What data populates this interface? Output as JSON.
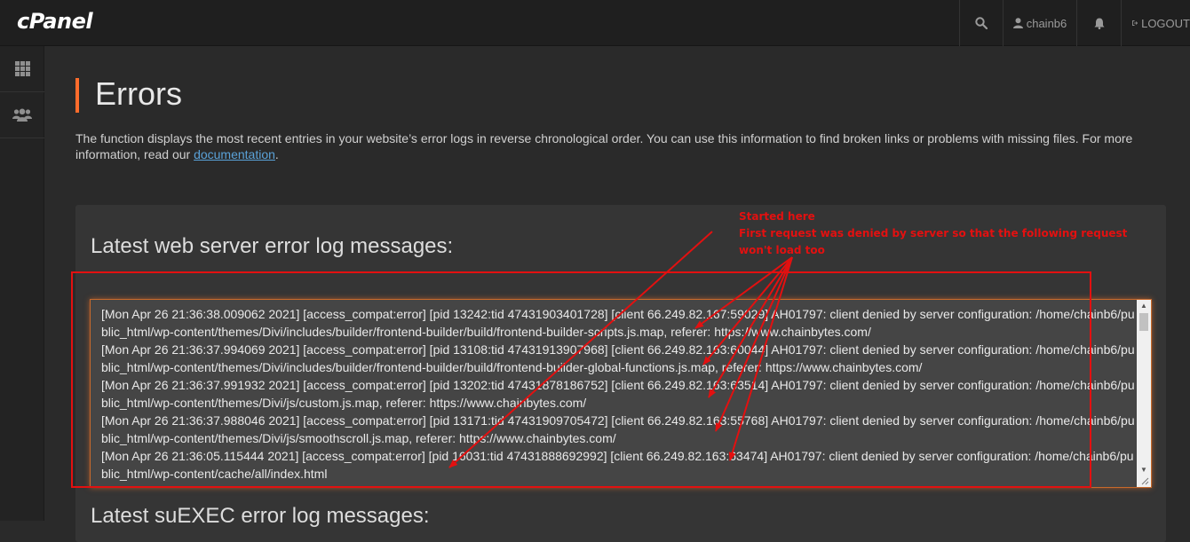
{
  "brand": "cPanel",
  "topnav": {
    "user": "chainb6",
    "logout": "LOGOUT"
  },
  "page": {
    "title": "Errors",
    "description_before": "The function displays the most recent entries in your website’s error logs in reverse chronological order. You can use this information to find broken links or problems with missing files. For more information, read our ",
    "doc_link": "documentation",
    "description_after": "."
  },
  "panel": {
    "heading": "Latest web server error log messages:",
    "next_heading": "Latest suEXEC error log messages:",
    "log_lines": [
      "[Mon Apr 26 21:36:38.009062 2021] [access_compat:error] [pid 13242:tid 47431903401728] [client 66.249.82.167:59029] AH01797: client denied by server configuration: /home/chainb6/public_html/wp-content/themes/Divi/includes/builder/frontend-builder/build/frontend-builder-scripts.js.map, referer: https://www.chainbytes.com/",
      "[Mon Apr 26 21:36:37.994069 2021] [access_compat:error] [pid 13108:tid 47431913907968] [client 66.249.82.163:60044] AH01797: client denied by server configuration: /home/chainb6/public_html/wp-content/themes/Divi/includes/builder/frontend-builder/build/frontend-builder-global-functions.js.map, referer: https://www.chainbytes.com/",
      "[Mon Apr 26 21:36:37.991932 2021] [access_compat:error] [pid 13202:tid 47431878186752] [client 66.249.82.163:63514] AH01797: client denied by server configuration: /home/chainb6/public_html/wp-content/themes/Divi/js/custom.js.map, referer: https://www.chainbytes.com/",
      "[Mon Apr 26 21:36:37.988046 2021] [access_compat:error] [pid 13171:tid 47431909705472] [client 66.249.82.163:55768] AH01797: client denied by server configuration: /home/chainb6/public_html/wp-content/themes/Divi/js/smoothscroll.js.map, referer: https://www.chainbytes.com/",
      "[Mon Apr 26 21:36:05.115444 2021] [access_compat:error] [pid 16031:tid 47431888692992] [client 66.249.82.163:63474] AH01797: client denied by server configuration: /home/chainb6/public_html/wp-content/cache/all/index.html"
    ]
  },
  "annotation": {
    "line1": "Started here",
    "line2": "First request was denied by server so that the following request",
    "line3": "won't load too",
    "color": "#e31010"
  },
  "colors": {
    "accent": "#ff6c2c",
    "link": "#5aa2d8",
    "background": "#2a2a2a",
    "topbar": "#1f1f1f"
  }
}
